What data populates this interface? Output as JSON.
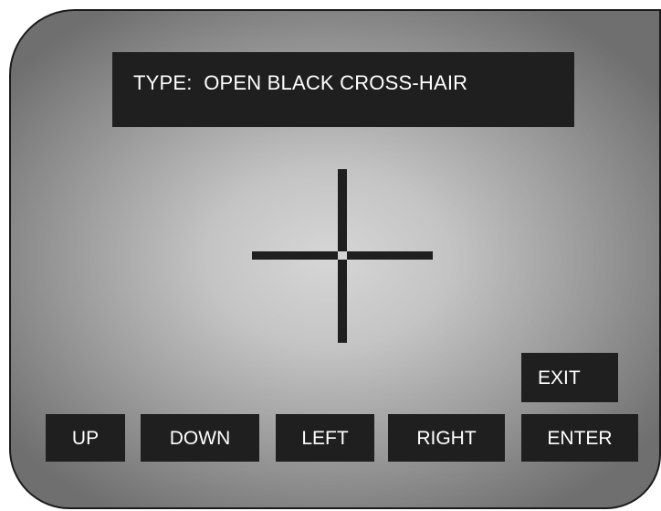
{
  "display": {
    "type_label": "TYPE:",
    "type_value": "OPEN BLACK CROSS-HAIR"
  },
  "crosshair": {
    "icon": "open-black-crosshair-icon",
    "color": "#1f1f1f"
  },
  "buttons": {
    "up": "UP",
    "down": "DOWN",
    "left": "LEFT",
    "right": "RIGHT",
    "enter": "ENTER",
    "exit": "EXIT"
  },
  "colors": {
    "panel": "#1f1f1f",
    "text": "#ffffff"
  }
}
